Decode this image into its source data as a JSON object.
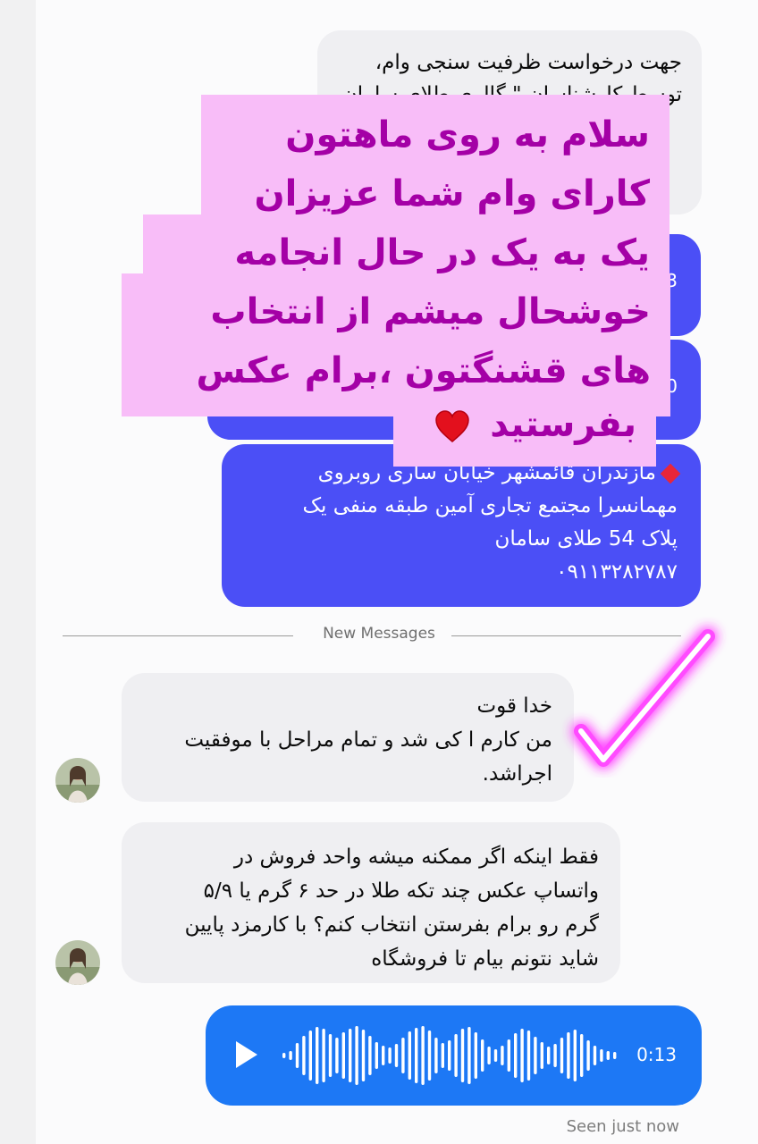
{
  "top_message": {
    "text": "جهت درخواست ظرفیت سنجی وام،\nتوسط کارشناسان \" گالری طلای سامان"
  },
  "voice_messages_out": [
    {
      "duration": "0:03"
    },
    {
      "duration": "0:40"
    }
  ],
  "address_message": {
    "text": "مازندران قائمشهر خیابان ساری روبروی\nمهمانسرا مجتمع تجاری آمین طبقه منفی یک\nپلاک 54 طلای سامان",
    "phone": "۰۹۱۱۳۲۸۲۷۸۷"
  },
  "story_overlay": {
    "lines": [
      "سلام به روی ماهتون",
      "کارای وام شما عزیزان",
      "یک به یک در حال انجامه",
      "خوشحال میشم از انتخاب",
      "های قشنگتون ،برام عکس",
      "بفرستید"
    ],
    "heart_icon": "red-heart-icon"
  },
  "divider": {
    "label": "New Messages"
  },
  "incoming_messages": [
    {
      "text": "خدا قوت\nمن کارم ا کی شد و تمام مراحل با موفقیت\nاجراشد."
    },
    {
      "text": "فقط اینکه اگر ممکنه میشه واحد فروش در\nواتساپ عکس چند تکه طلا در حد ۶ گرم یا ۵/۹\nگرم رو برام بفرستن انتخاب کنم؟ با کارمزد پایین\nشاید نتونم بیام تا فروشگاه"
    }
  ],
  "voice_message_in": {
    "duration": "0:13"
  },
  "status": {
    "seen": "Seen just now"
  },
  "colors": {
    "out_bubble": "#4b4ff6",
    "in_bubble": "#efeff2",
    "voice_blue": "#1d78f5",
    "overlay_bg": "#f8bdf8",
    "overlay_text": "#a400a6",
    "neon": "#ff4cff"
  }
}
